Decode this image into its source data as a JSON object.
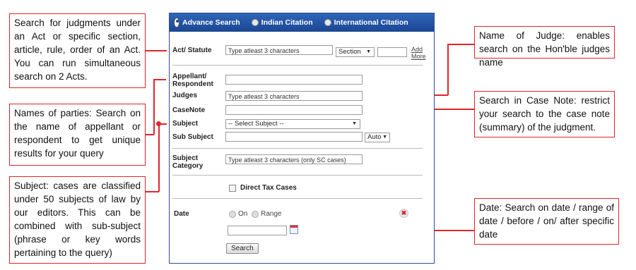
{
  "annotations": {
    "act": "Search for judgments under an Act or specific section, article, rule, order of an Act. You can run simultaneous search on 2 Acts.",
    "parties": "Names of parties: Search on the name of appellant or respondent to get unique results for your query",
    "subject": "Subject: cases are classified under 50 subjects of law by our editors. This can be combined with sub-subject (phrase or key words pertaining to the query)",
    "judge": "Name of Judge: enables search on the Hon'ble judges name",
    "casenote": "Search in Case Note: restrict your search to the case note (summary) of the judgment.",
    "date": "Date: Search on date / range of date / before / on/ after specific date"
  },
  "tabs": [
    {
      "label": "Advance Search",
      "selected": true
    },
    {
      "label": "Indian Citation",
      "selected": false
    },
    {
      "label": "International Citation",
      "selected": false
    }
  ],
  "form": {
    "act_label": "Act/ Statute",
    "act_placeholder": "Type atleast 3 characters",
    "section_label": "Section",
    "add_more_line1": "Add",
    "add_more_line2": "More",
    "appellant_label_1": "Appellant/",
    "appellant_label_2": "Respondent",
    "judges_label": "Judges",
    "judges_placeholder": "Type atleast 3 characters",
    "casenote_label": "CaseNote",
    "subject_label": "Subject",
    "subject_select": "-- Select Subject --",
    "subsubject_label": "Sub Subject",
    "auto_label": "Auto",
    "subject_category_label_1": "Subject",
    "subject_category_label_2": "Category",
    "subject_category_placeholder": "Type atleast 3 characters (only SC cases)",
    "direct_tax_label": "Direct Tax Cases",
    "date_label": "Date",
    "on_label": "On",
    "range_label": "Range",
    "search_button": "Search"
  },
  "colors": {
    "annotation": "#e0242c",
    "tabbar": "#1b4792"
  }
}
